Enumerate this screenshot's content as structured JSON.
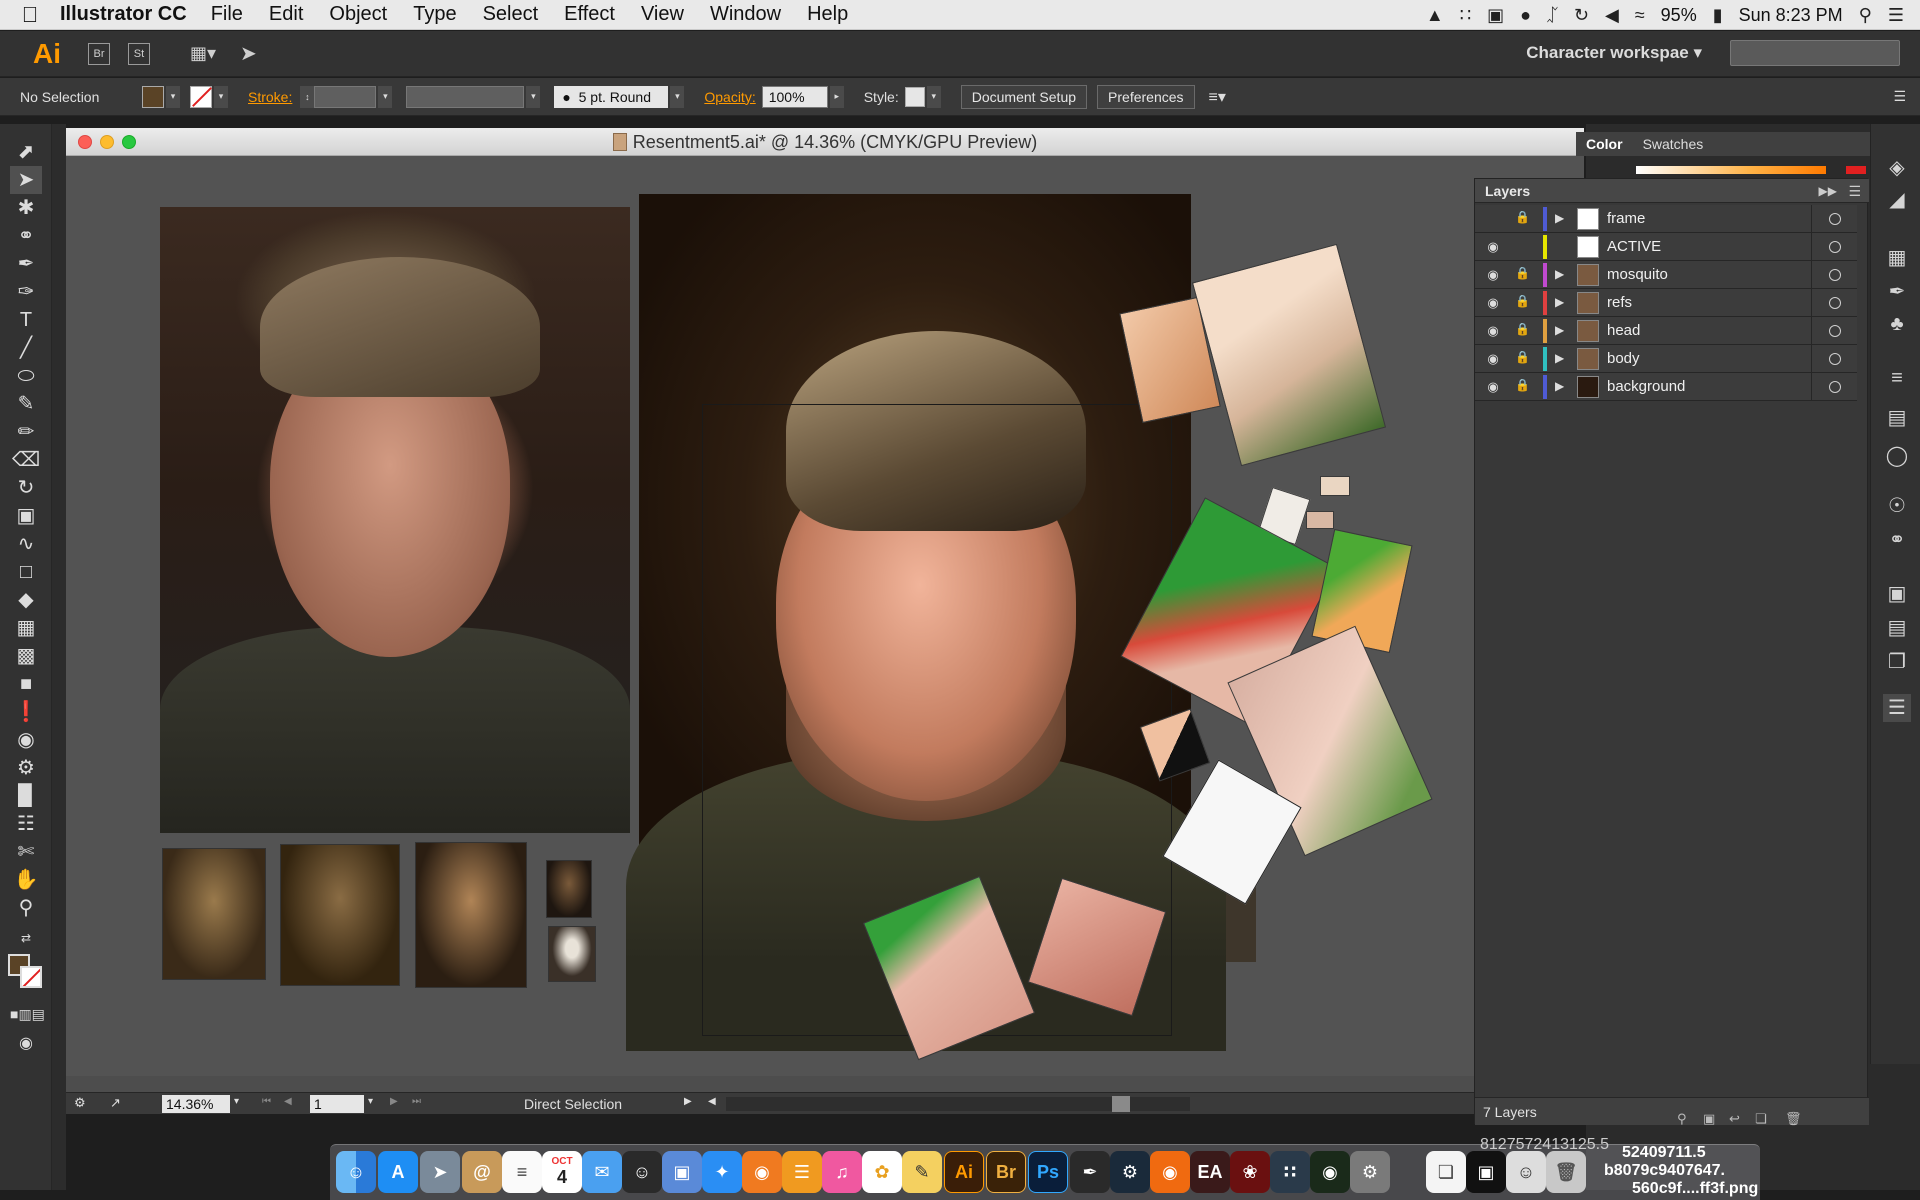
{
  "menubar": {
    "app_name": "Illustrator CC",
    "menus": [
      "File",
      "Edit",
      "Object",
      "Type",
      "Select",
      "Effect",
      "View",
      "Window",
      "Help"
    ],
    "battery": "95%",
    "clock": "Sun 8:23 PM",
    "status_icons": [
      "drive-icon",
      "grid-icon",
      "display-icon",
      "cc-icon",
      "bluetooth-icon",
      "time-machine-icon",
      "volume-icon",
      "wifi-icon",
      "battery-icon",
      "spotlight-icon",
      "notification-icon"
    ]
  },
  "appbar": {
    "logo": "Ai",
    "bridge": "Br",
    "stock": "St",
    "workspace": "Character workspae",
    "search_placeholder": ""
  },
  "controlbar": {
    "selection": "No Selection",
    "stroke_label": "Stroke:",
    "brush": "5 pt. Round",
    "opacity_label": "Opacity:",
    "opacity_value": "100%",
    "style_label": "Style:",
    "document_setup": "Document Setup",
    "preferences": "Preferences",
    "fill_color": "#5a4326"
  },
  "document": {
    "title": "Resentment5.ai* @ 14.36% (CMYK/GPU Preview)",
    "zoom": "14.36%",
    "artboard": "1",
    "tool_status": "Direct Selection"
  },
  "color_panel": {
    "tabs": [
      "Color",
      "Swatches"
    ]
  },
  "layers_panel": {
    "title": "Layers",
    "footer_count": "7 Layers",
    "layers": [
      {
        "name": "frame",
        "visible": false,
        "locked": true,
        "color": "#4f5bd5",
        "has_children": true
      },
      {
        "name": "ACTIVE",
        "visible": true,
        "locked": false,
        "color": "#e6e600",
        "has_children": false
      },
      {
        "name": "mosquito",
        "visible": true,
        "locked": true,
        "color": "#c04ad0",
        "has_children": true
      },
      {
        "name": "refs",
        "visible": true,
        "locked": true,
        "color": "#e04040",
        "has_children": true
      },
      {
        "name": "head",
        "visible": true,
        "locked": true,
        "color": "#e0a040",
        "has_children": true
      },
      {
        "name": "body",
        "visible": true,
        "locked": true,
        "color": "#30c0c0",
        "has_children": true
      },
      {
        "name": "background",
        "visible": true,
        "locked": true,
        "color": "#4f5bd5",
        "has_children": true
      }
    ]
  },
  "dock": {
    "apps": [
      "Finder",
      "App Store",
      "Launchpad",
      "Contacts",
      "Reminders",
      "Calendar",
      "Messages",
      "Photo Booth",
      "Preview",
      "Safari",
      "Firefox",
      "iBooks",
      "iTunes",
      "Photos",
      "Notes",
      "Ai",
      "Br",
      "Ps",
      "Pen",
      "Steam",
      "Chrome",
      "EA",
      "Kirby",
      "Grid",
      "Mic",
      "Preferences"
    ],
    "calendar_month": "OCT",
    "calendar_day": "4"
  },
  "desktop_labels": [
    "8127572413125.5",
    "52409711.5",
    "b8079c9407647.",
    "560c9f....ff3f.png"
  ]
}
